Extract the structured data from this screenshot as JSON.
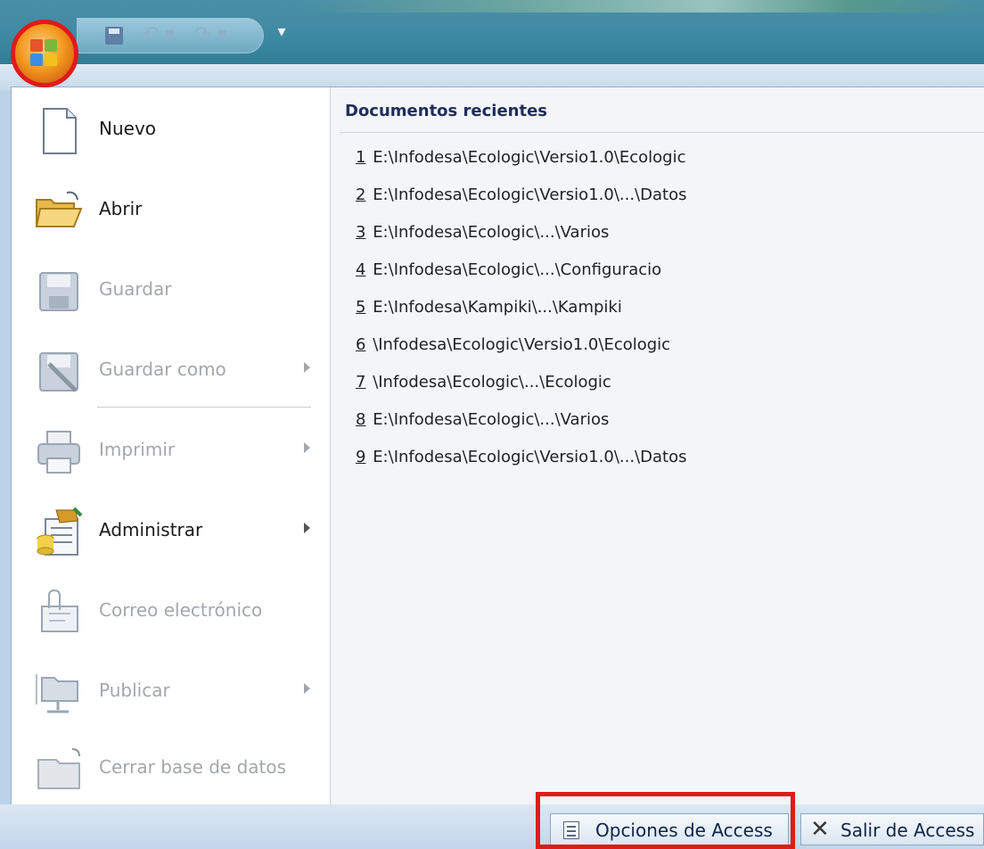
{
  "quick_access": {
    "icons": [
      "office-button",
      "save-icon",
      "undo-icon",
      "redo-icon",
      "customize-qat-icon"
    ]
  },
  "menu": {
    "commands": [
      {
        "key": "nuevo",
        "label": "Nuevo",
        "icon": "new-document-icon",
        "enabled": true,
        "submenu": false
      },
      {
        "key": "abrir",
        "label": "Abrir",
        "icon": "open-folder-icon",
        "enabled": true,
        "submenu": false
      },
      {
        "key": "guardar",
        "label": "Guardar",
        "icon": "save-disk-icon",
        "enabled": false,
        "submenu": false
      },
      {
        "key": "guardar-como",
        "label": "Guardar como",
        "icon": "save-as-icon",
        "enabled": false,
        "submenu": true
      },
      {
        "key": "imprimir",
        "label": "Imprimir",
        "icon": "printer-icon",
        "enabled": false,
        "submenu": true
      },
      {
        "key": "administrar",
        "label": "Administrar",
        "icon": "manage-database-icon",
        "enabled": true,
        "submenu": true
      },
      {
        "key": "correo",
        "label": "Correo electrónico",
        "icon": "email-attachment-icon",
        "enabled": false,
        "submenu": false
      },
      {
        "key": "publicar",
        "label": "Publicar",
        "icon": "publish-folder-icon",
        "enabled": false,
        "submenu": true
      },
      {
        "key": "cerrar",
        "label": "Cerrar base de datos",
        "icon": "close-database-icon",
        "enabled": false,
        "submenu": false
      }
    ]
  },
  "recent": {
    "heading": "Documentos recientes",
    "items": [
      {
        "num": "1",
        "path": "E:\\Infodesa\\Ecologic\\Versio1.0\\Ecologic"
      },
      {
        "num": "2",
        "path": "E:\\Infodesa\\Ecologic\\Versio1.0\\...\\Datos"
      },
      {
        "num": "3",
        "path": "E:\\Infodesa\\Ecologic\\...\\Varios"
      },
      {
        "num": "4",
        "path": "E:\\Infodesa\\Ecologic\\...\\Configuracio"
      },
      {
        "num": "5",
        "path": "E:\\Infodesa\\Kampiki\\...\\Kampiki"
      },
      {
        "num": "6",
        "path": "\\Infodesa\\Ecologic\\Versio1.0\\Ecologic"
      },
      {
        "num": "7",
        "path": "\\Infodesa\\Ecologic\\...\\Ecologic"
      },
      {
        "num": "8",
        "path": "E:\\Infodesa\\Ecologic\\...\\Varios"
      },
      {
        "num": "9",
        "path": "E:\\Infodesa\\Ecologic\\Versio1.0\\...\\Datos"
      }
    ]
  },
  "footer": {
    "options_label": "Opciones de Access",
    "exit_label": "Salir de Access"
  },
  "colors": {
    "highlight": "#e01a1a",
    "heading": "#1f2d5c",
    "disabled_text": "#a3a7ac"
  }
}
